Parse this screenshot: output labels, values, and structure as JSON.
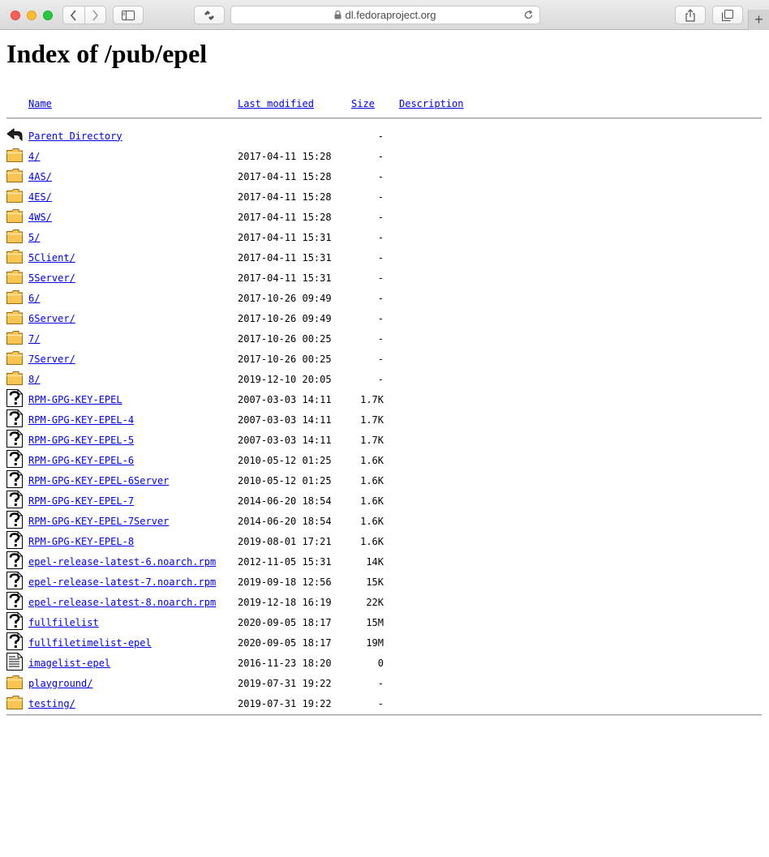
{
  "browser": {
    "url": "dl.fedoraproject.org",
    "new_tab": "+"
  },
  "page": {
    "title": "Index of /pub/epel"
  },
  "columns": {
    "name": "Name",
    "modified": "Last modified",
    "size": "Size",
    "description": "Description"
  },
  "entries": [
    {
      "icon": "back-icon",
      "name": "Parent Directory",
      "modified": "",
      "size": "-"
    },
    {
      "icon": "folder-icon",
      "name": "4/",
      "modified": "2017-04-11 15:28",
      "size": "-"
    },
    {
      "icon": "folder-icon",
      "name": "4AS/",
      "modified": "2017-04-11 15:28",
      "size": "-"
    },
    {
      "icon": "folder-icon",
      "name": "4ES/",
      "modified": "2017-04-11 15:28",
      "size": "-"
    },
    {
      "icon": "folder-icon",
      "name": "4WS/",
      "modified": "2017-04-11 15:28",
      "size": "-"
    },
    {
      "icon": "folder-icon",
      "name": "5/",
      "modified": "2017-04-11 15:31",
      "size": "-"
    },
    {
      "icon": "folder-icon",
      "name": "5Client/",
      "modified": "2017-04-11 15:31",
      "size": "-"
    },
    {
      "icon": "folder-icon",
      "name": "5Server/",
      "modified": "2017-04-11 15:31",
      "size": "-"
    },
    {
      "icon": "folder-icon",
      "name": "6/",
      "modified": "2017-10-26 09:49",
      "size": "-"
    },
    {
      "icon": "folder-icon",
      "name": "6Server/",
      "modified": "2017-10-26 09:49",
      "size": "-"
    },
    {
      "icon": "folder-icon",
      "name": "7/",
      "modified": "2017-10-26 00:25",
      "size": "-"
    },
    {
      "icon": "folder-icon",
      "name": "7Server/",
      "modified": "2017-10-26 00:25",
      "size": "-"
    },
    {
      "icon": "folder-icon",
      "name": "8/",
      "modified": "2019-12-10 20:05",
      "size": "-"
    },
    {
      "icon": "unknown-file-icon",
      "name": "RPM-GPG-KEY-EPEL",
      "modified": "2007-03-03 14:11",
      "size": "1.7K"
    },
    {
      "icon": "unknown-file-icon",
      "name": "RPM-GPG-KEY-EPEL-4",
      "modified": "2007-03-03 14:11",
      "size": "1.7K"
    },
    {
      "icon": "unknown-file-icon",
      "name": "RPM-GPG-KEY-EPEL-5",
      "modified": "2007-03-03 14:11",
      "size": "1.7K"
    },
    {
      "icon": "unknown-file-icon",
      "name": "RPM-GPG-KEY-EPEL-6",
      "modified": "2010-05-12 01:25",
      "size": "1.6K"
    },
    {
      "icon": "unknown-file-icon",
      "name": "RPM-GPG-KEY-EPEL-6Server",
      "modified": "2010-05-12 01:25",
      "size": "1.6K"
    },
    {
      "icon": "unknown-file-icon",
      "name": "RPM-GPG-KEY-EPEL-7",
      "modified": "2014-06-20 18:54",
      "size": "1.6K"
    },
    {
      "icon": "unknown-file-icon",
      "name": "RPM-GPG-KEY-EPEL-7Server",
      "modified": "2014-06-20 18:54",
      "size": "1.6K"
    },
    {
      "icon": "unknown-file-icon",
      "name": "RPM-GPG-KEY-EPEL-8",
      "modified": "2019-08-01 17:21",
      "size": "1.6K"
    },
    {
      "icon": "unknown-file-icon",
      "name": "epel-release-latest-6.noarch.rpm",
      "modified": "2012-11-05 15:31",
      "size": "14K"
    },
    {
      "icon": "unknown-file-icon",
      "name": "epel-release-latest-7.noarch.rpm",
      "modified": "2019-09-18 12:56",
      "size": "15K"
    },
    {
      "icon": "unknown-file-icon",
      "name": "epel-release-latest-8.noarch.rpm",
      "modified": "2019-12-18 16:19",
      "size": "22K"
    },
    {
      "icon": "unknown-file-icon",
      "name": "fullfilelist",
      "modified": "2020-09-05 18:17",
      "size": "15M"
    },
    {
      "icon": "unknown-file-icon",
      "name": "fullfiletimelist-epel",
      "modified": "2020-09-05 18:17",
      "size": "19M"
    },
    {
      "icon": "text-file-icon",
      "name": "imagelist-epel",
      "modified": "2016-11-23 18:20",
      "size": "0"
    },
    {
      "icon": "folder-icon",
      "name": "playground/",
      "modified": "2019-07-31 19:22",
      "size": "-"
    },
    {
      "icon": "folder-icon",
      "name": "testing/",
      "modified": "2019-07-31 19:22",
      "size": "-"
    }
  ],
  "colors": {
    "link": "#0000ee",
    "folder_fill": "#f8c552",
    "folder_stroke": "#9a6a10"
  }
}
